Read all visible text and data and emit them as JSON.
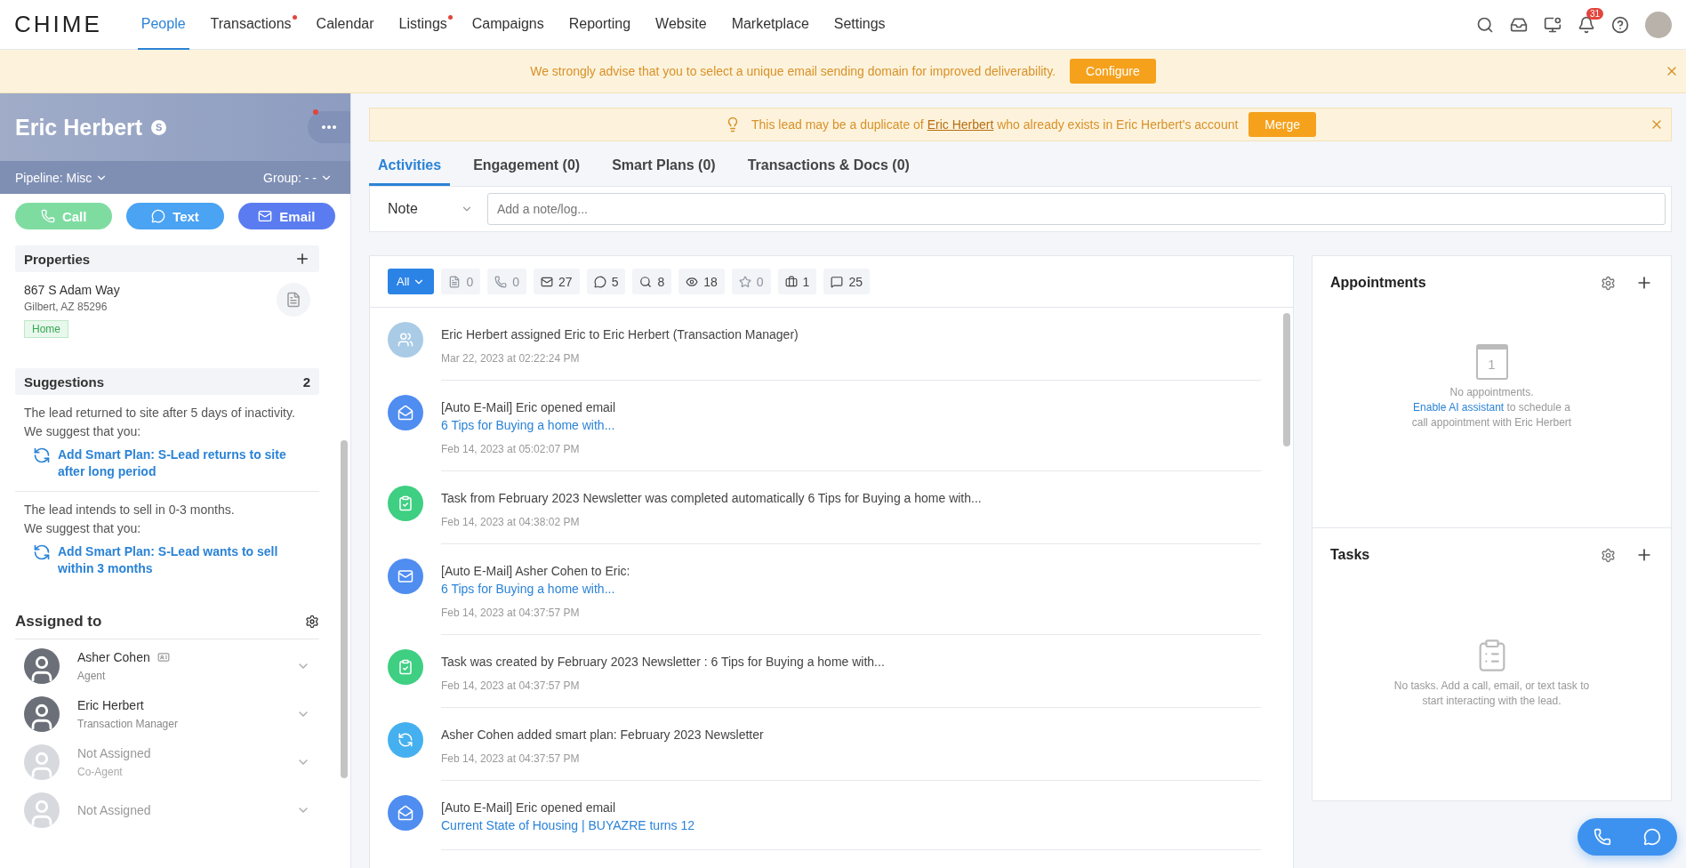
{
  "brand": {
    "logo": "CHIME"
  },
  "nav": [
    {
      "label": "People",
      "selected": true,
      "dot": false
    },
    {
      "label": "Transactions",
      "selected": false,
      "dot": true
    },
    {
      "label": "Calendar",
      "selected": false,
      "dot": false
    },
    {
      "label": "Listings",
      "selected": false,
      "dot": true
    },
    {
      "label": "Campaigns",
      "selected": false,
      "dot": false
    },
    {
      "label": "Reporting",
      "selected": false,
      "dot": false
    },
    {
      "label": "Website",
      "selected": false,
      "dot": false
    },
    {
      "label": "Marketplace",
      "selected": false,
      "dot": false
    },
    {
      "label": "Settings",
      "selected": false,
      "dot": false
    }
  ],
  "notifications_badge": "31",
  "banner": {
    "text": "We strongly advise that you to select a unique email sending domain for improved deliverability.",
    "button": "Configure"
  },
  "lead": {
    "name": "Eric Herbert",
    "source_badge": "S",
    "pipeline_label": "Pipeline:",
    "pipeline": "Misc",
    "group_label": "Group:",
    "group": "- -",
    "actions": [
      {
        "kind": "call",
        "label": "Call"
      },
      {
        "kind": "text",
        "label": "Text"
      },
      {
        "kind": "email",
        "label": "Email"
      }
    ]
  },
  "properties": {
    "title": "Properties",
    "address": "867 S Adam Way",
    "city": "Gilbert, AZ 85296",
    "tag": "Home"
  },
  "suggestions": {
    "title": "Suggestions",
    "count": "2",
    "items": [
      {
        "reason": "The lead returned to site after 5 days of inactivity.",
        "prompt": "We suggest that you:",
        "action": "Add Smart Plan: S-Lead returns to site after long period"
      },
      {
        "reason": "The lead intends to sell in 0-3 months.",
        "prompt": "We suggest that you:",
        "action": "Add Smart Plan: S-Lead wants to sell within 3 months"
      }
    ]
  },
  "assigned": {
    "title": "Assigned to",
    "people": [
      {
        "name": "Asher Cohen",
        "role": "Agent",
        "assigned": true,
        "card": true
      },
      {
        "name": "Eric Herbert",
        "role": "Transaction Manager",
        "assigned": true,
        "card": false
      },
      {
        "name": "Not Assigned",
        "role": "Co-Agent",
        "assigned": false,
        "card": false
      },
      {
        "name": "Not Assigned",
        "assigned": false,
        "card": false
      }
    ]
  },
  "duplicate": {
    "before": "This lead may be a duplicate of ",
    "link": "Eric Herbert",
    "after": " who already exists in Eric Herbert's account",
    "button": "Merge"
  },
  "tabs": [
    {
      "label": "Activities",
      "selected": true
    },
    {
      "label": "Engagement (0)",
      "selected": false
    },
    {
      "label": "Smart Plans (0)",
      "selected": false
    },
    {
      "label": "Transactions & Docs (0)",
      "selected": false
    }
  ],
  "note": {
    "type": "Note",
    "placeholder": "Add a note/log..."
  },
  "filters": {
    "all": "All",
    "chips": [
      {
        "kind": "note",
        "count": "0",
        "disabled": true
      },
      {
        "kind": "call",
        "count": "0",
        "disabled": true
      },
      {
        "kind": "email",
        "count": "27",
        "disabled": false
      },
      {
        "kind": "text",
        "count": "5",
        "disabled": false
      },
      {
        "kind": "search",
        "count": "8",
        "disabled": false
      },
      {
        "kind": "view",
        "count": "18",
        "disabled": false
      },
      {
        "kind": "favorite",
        "count": "0",
        "disabled": true
      },
      {
        "kind": "transaction",
        "count": "1",
        "disabled": false
      },
      {
        "kind": "message",
        "count": "25",
        "disabled": false
      }
    ]
  },
  "activities": [
    {
      "kind": "assign",
      "text": "Eric Herbert assigned Eric to Eric Herbert (Transaction Manager)",
      "time": "Mar 22, 2023 at 02:22:24 PM"
    },
    {
      "kind": "email_open",
      "text": "[Auto E-Mail] Eric opened email",
      "link": "6 Tips for Buying a home with...",
      "time": "Feb 14, 2023 at 05:02:07 PM"
    },
    {
      "kind": "task",
      "text": "Task from February 2023 Newsletter was completed automatically 6 Tips for Buying a home with...",
      "time": "Feb 14, 2023 at 04:38:02 PM"
    },
    {
      "kind": "email",
      "text": "[Auto E-Mail] Asher Cohen to Eric:",
      "link": "6 Tips for Buying a home with...",
      "time": "Feb 14, 2023 at 04:37:57 PM"
    },
    {
      "kind": "task",
      "text": "Task was created by February 2023 Newsletter : 6 Tips for Buying a home with...",
      "time": "Feb 14, 2023 at 04:37:57 PM"
    },
    {
      "kind": "smartplan",
      "text": "Asher Cohen added smart plan: February 2023 Newsletter",
      "time": "Feb 14, 2023 at 04:37:57 PM"
    },
    {
      "kind": "email_open",
      "text": "[Auto E-Mail] Eric opened email",
      "link": "Current State of Housing | BUYAZRE turns 12"
    }
  ],
  "appointments": {
    "title": "Appointments",
    "calendar_day": "1",
    "empty_before": "No appointments. ",
    "empty_link": "Enable AI assistant",
    "empty_after": " to schedule a call appointment with Eric Herbert"
  },
  "tasks": {
    "title": "Tasks",
    "empty": "No tasks. Add a call, email, or text task to start interacting with the lead."
  }
}
